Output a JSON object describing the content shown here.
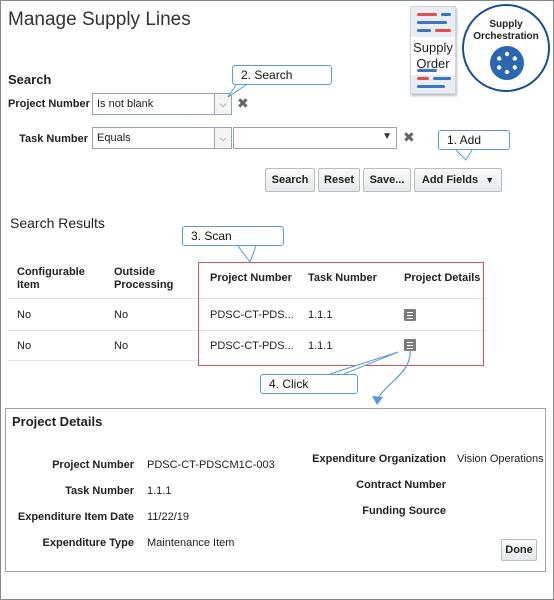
{
  "page": {
    "title": "Manage Supply Lines"
  },
  "badges": {
    "supply_order": "Supply\nOrder",
    "supply_orchestration": "Supply\nOrchestration"
  },
  "search": {
    "title": "Search",
    "project_number": {
      "label": "Project Number",
      "operator": "Is not blank"
    },
    "task_number": {
      "label": "Task Number",
      "operator": "Equals",
      "value": ""
    },
    "buttons": {
      "search": "Search",
      "reset": "Reset",
      "save": "Save...",
      "add_fields": "Add Fields"
    }
  },
  "callouts": {
    "step1": "1. Add",
    "step2": "2. Search",
    "step3": "3. Scan",
    "step4": "4. Click"
  },
  "results": {
    "title": "Search Results",
    "columns": [
      "Configurable Item",
      "Outside Processing",
      "Project Number",
      "Task Number",
      "Project Details"
    ],
    "rows": [
      {
        "configurable_item": "No",
        "outside_processing": "No",
        "project_number": "PDSC-CT-PDS...",
        "task_number": "1.1.1"
      },
      {
        "configurable_item": "No",
        "outside_processing": "No",
        "project_number": "PDSC-CT-PDS...",
        "task_number": "1.1.1"
      }
    ]
  },
  "details": {
    "title": "Project Details",
    "left": [
      {
        "label": "Project Number",
        "value": "PDSC-CT-PDSCM1C-003"
      },
      {
        "label": "Task Number",
        "value": "1.1.1"
      },
      {
        "label": "Expenditure Item Date",
        "value": "11/22/19"
      },
      {
        "label": "Expenditure Type",
        "value": "Maintenance Item"
      }
    ],
    "right": [
      {
        "label": "Expenditure Organization",
        "value": "Vision Operations"
      },
      {
        "label": "Contract Number",
        "value": ""
      },
      {
        "label": "Funding Source",
        "value": ""
      }
    ],
    "done": "Done"
  },
  "colors": {
    "callout_border": "#5a9bd5",
    "highlight_box": "#d9534f",
    "orchestration_blue": "#2a66b1"
  }
}
